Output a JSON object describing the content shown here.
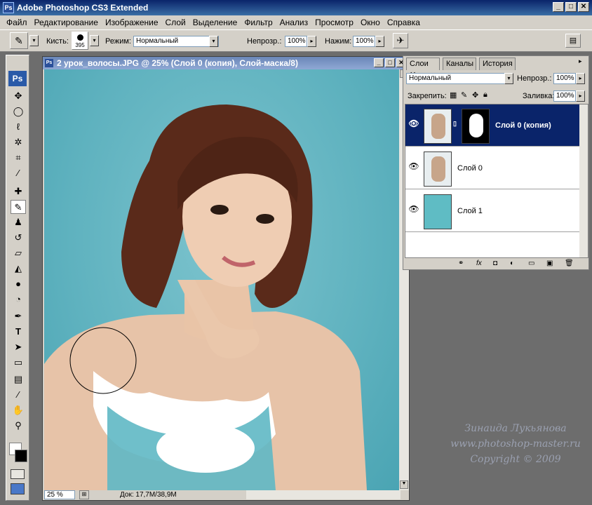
{
  "app": {
    "title": "Adobe Photoshop CS3 Extended",
    "icon": "Ps",
    "window_buttons": [
      "_",
      "□",
      "✕"
    ]
  },
  "menu": [
    "Файл",
    "Редактирование",
    "Изображение",
    "Слой",
    "Выделение",
    "Фильтр",
    "Анализ",
    "Просмотр",
    "Окно",
    "Справка"
  ],
  "options": {
    "brush_label": "Кисть:",
    "brush_size": "395",
    "mode_label": "Режим:",
    "mode_value": "Нормальный",
    "opacity_label": "Непрозр.:",
    "opacity_value": "100%",
    "flow_label": "Нажим:",
    "flow_value": "100%"
  },
  "toolbox": {
    "logo": "Ps",
    "tools": [
      "move-icon",
      "marquee-icon",
      "lasso-icon",
      "magic-wand-icon",
      "crop-icon",
      "eyedropper-icon",
      "healing-icon",
      "brush-icon",
      "stamp-icon",
      "history-brush-icon",
      "eraser-icon",
      "bucket-icon",
      "blur-icon",
      "dodge-icon",
      "pen-icon",
      "type-icon",
      "path-select-icon",
      "shape-icon",
      "notes-icon",
      "eyedropper2-icon",
      "hand-icon",
      "zoom-icon"
    ]
  },
  "document": {
    "title": "2 урок_волосы.JPG @ 25% (Слой 0 (копия), Слой-маска/8)",
    "zoom": "25 %",
    "doc_info": "Док: 17,7M/38,9M"
  },
  "layers_panel": {
    "tabs": [
      "Слои",
      "Каналы",
      "История"
    ],
    "blend_mode": "Нормальный",
    "opacity_label": "Непрозр.:",
    "opacity_value": "100%",
    "lock_label": "Закрепить:",
    "fill_label": "Заливка:",
    "fill_value": "100%",
    "layers": [
      {
        "name": "Слой 0 (копия)",
        "selected": true
      },
      {
        "name": "Слой 0",
        "selected": false
      },
      {
        "name": "Слой 1",
        "selected": false
      }
    ]
  },
  "watermark": {
    "author": "Зинаида Лукьянова",
    "site": "www.photoshop-master.ru",
    "copyright": "Copyright © 2009"
  },
  "colors": {
    "selection": "#0a246a",
    "canvas_bg": "#5fb2bf",
    "chrome": "#d4d0c8"
  }
}
